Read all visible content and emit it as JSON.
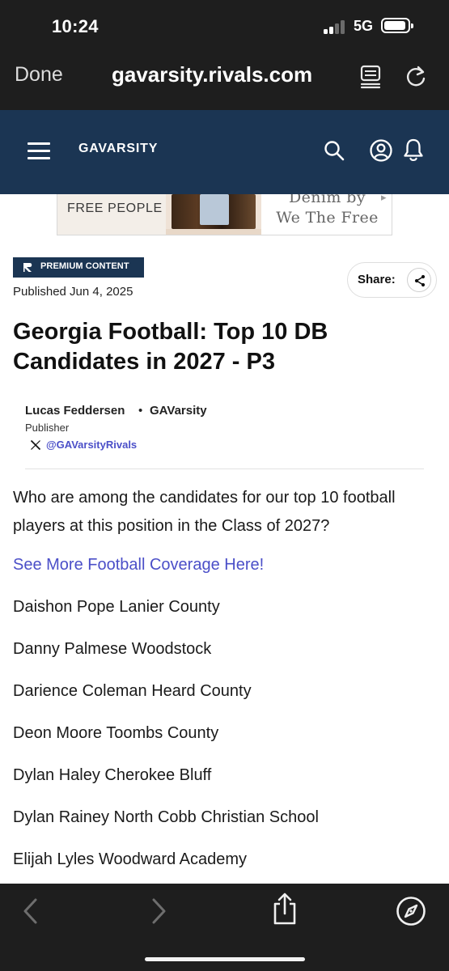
{
  "status_bar": {
    "time": "10:24",
    "network": "5G"
  },
  "browser": {
    "done_label": "Done",
    "url": "gavarsity.rivals.com"
  },
  "site": {
    "brand": "GAVARSITY"
  },
  "ad": {
    "brand": "FREE PEOPLE",
    "tagline_line1": "Denim by",
    "tagline_line2": "We The Free"
  },
  "article": {
    "badge": "PREMIUM CONTENT",
    "published": "Published Jun 4, 2025",
    "share_label": "Share:",
    "title": "Georgia Football: Top 10 DB Candidates in 2027 - P3",
    "author": {
      "name": "Lucas Feddersen",
      "separator": "•",
      "outlet": "GAVarsity",
      "role": "Publisher",
      "handle": "@GAVarsityRivals"
    },
    "intro": "Who are among the candidates for our top 10 football players at this position in the Class of 2027?",
    "more_link": "See More Football Coverage Here!",
    "players": [
      "Daishon Pope Lanier County",
      "Danny Palmese Woodstock",
      "Darience Coleman Heard County",
      "Deon Moore Toombs County",
      "Dylan Haley Cherokee Bluff",
      "Dylan Rainey North Cobb Christian School",
      "Elijah Lyles Woodward Academy"
    ]
  },
  "icons": {
    "menu": "menu-icon",
    "search": "search-icon",
    "account": "account-icon",
    "notifications": "bell-icon",
    "share": "share-icon",
    "x": "x-logo-icon",
    "back": "back-icon",
    "forward": "forward-icon",
    "share_sheet": "share-sheet-icon",
    "compass": "compass-icon",
    "reader": "reader-icon",
    "reload": "reload-icon"
  },
  "colors": {
    "header_bg": "#1b3553",
    "chrome_bg": "#1e1e1e",
    "link": "#4b4fc8"
  }
}
